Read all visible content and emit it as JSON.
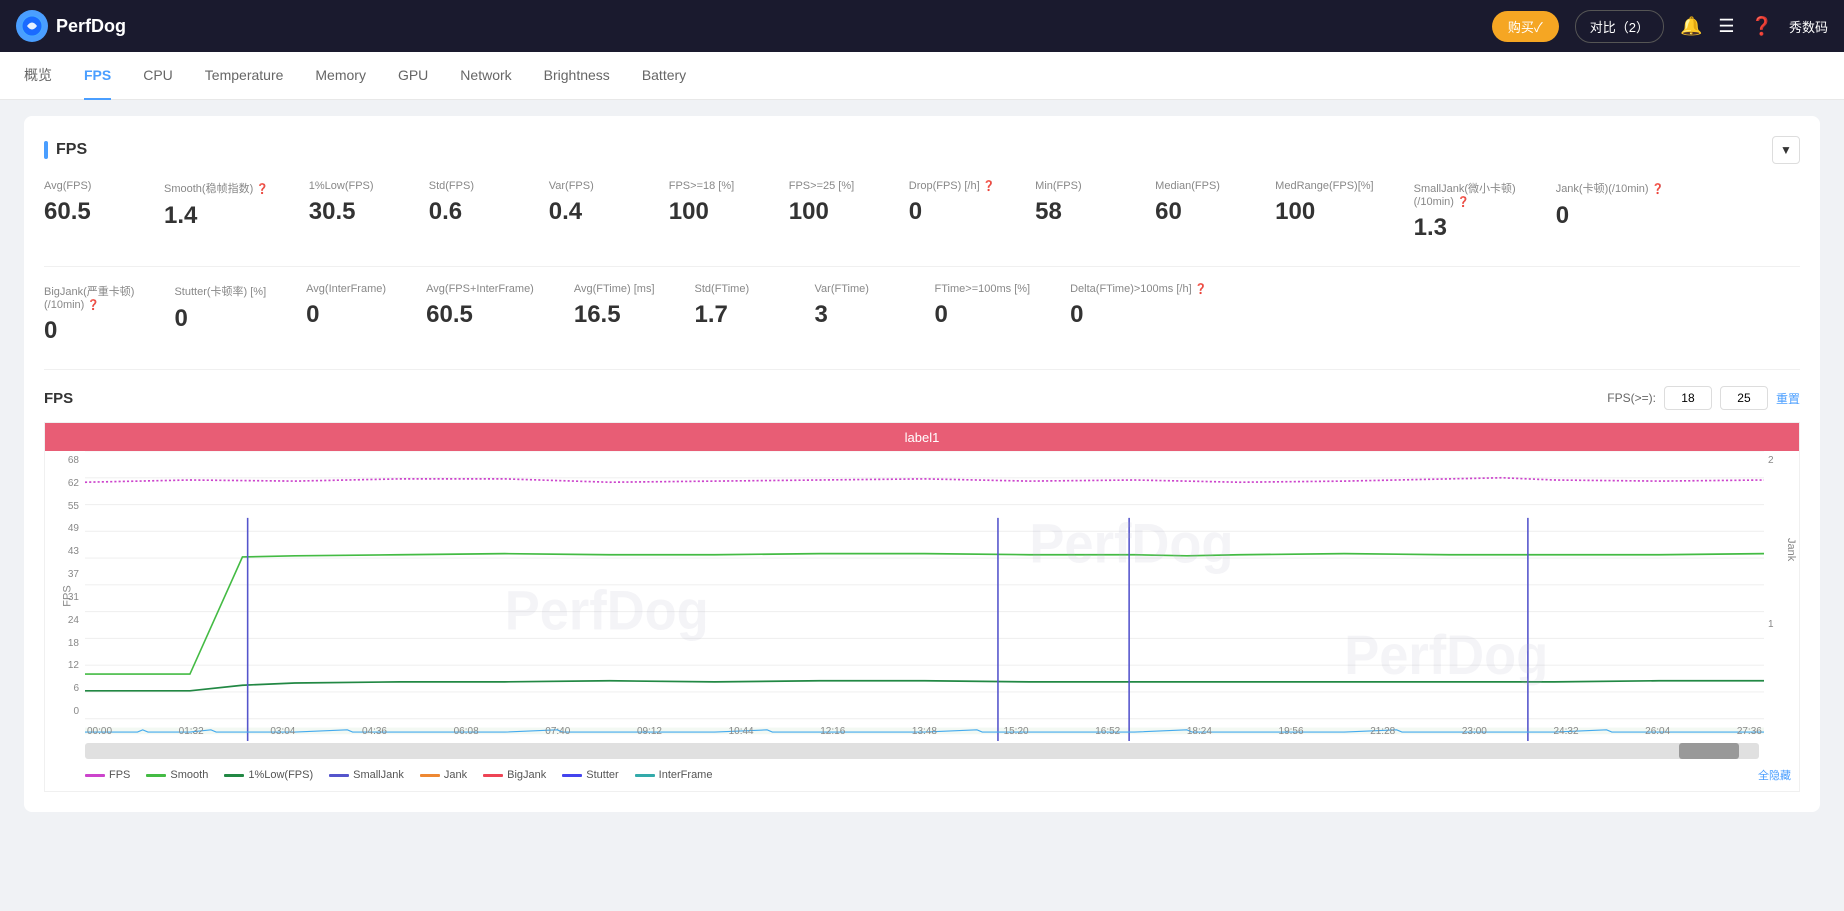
{
  "app": {
    "logo_text": "PerfDog",
    "buy_btn": "购买✓",
    "compare_btn": "对比（2）",
    "user_icon": "🔔",
    "menu_icon": "≡",
    "help_icon": "?",
    "user_text": "秀数码"
  },
  "nav": {
    "items": [
      {
        "label": "概览",
        "active": false
      },
      {
        "label": "FPS",
        "active": true
      },
      {
        "label": "CPU",
        "active": false
      },
      {
        "label": "Temperature",
        "active": false
      },
      {
        "label": "Memory",
        "active": false
      },
      {
        "label": "GPU",
        "active": false
      },
      {
        "label": "Network",
        "active": false
      },
      {
        "label": "Brightness",
        "active": false
      },
      {
        "label": "Battery",
        "active": false
      }
    ]
  },
  "fps_section": {
    "title": "FPS",
    "stats_row1": [
      {
        "label": "Avg(FPS)",
        "value": "60.5",
        "help": false
      },
      {
        "label": "Smooth(稳帧指数)",
        "value": "1.4",
        "help": true
      },
      {
        "label": "1%Low(FPS)",
        "value": "30.5",
        "help": false
      },
      {
        "label": "Std(FPS)",
        "value": "0.6",
        "help": false
      },
      {
        "label": "Var(FPS)",
        "value": "0.4",
        "help": false
      },
      {
        "label": "FPS>=18 [%]",
        "value": "100",
        "help": false
      },
      {
        "label": "FPS>=25 [%]",
        "value": "100",
        "help": false
      },
      {
        "label": "Drop(FPS) [/h]",
        "value": "0",
        "help": true
      },
      {
        "label": "Min(FPS)",
        "value": "58",
        "help": false
      },
      {
        "label": "Median(FPS)",
        "value": "60",
        "help": false
      },
      {
        "label": "MedRange(FPS)[%]",
        "value": "100",
        "help": false
      },
      {
        "label": "SmallJank(微小卡顿)(/10min)",
        "value": "1.3",
        "help": true
      },
      {
        "label": "Jank(卡顿)(/10min)",
        "value": "0",
        "help": true
      }
    ],
    "stats_row2": [
      {
        "label": "BigJank(严重卡顿)(/10min)",
        "value": "0",
        "help": true
      },
      {
        "label": "Stutter(卡顿率) [%]",
        "value": "0",
        "help": false
      },
      {
        "label": "Avg(InterFrame)",
        "value": "0",
        "help": false
      },
      {
        "label": "Avg(FPS+InterFrame)",
        "value": "60.5",
        "help": false
      },
      {
        "label": "Avg(FTime) [ms]",
        "value": "16.5",
        "help": false
      },
      {
        "label": "Std(FTime)",
        "value": "1.7",
        "help": false
      },
      {
        "label": "Var(FTime)",
        "value": "3",
        "help": false
      },
      {
        "label": "FTime>=100ms [%]",
        "value": "0",
        "help": false
      },
      {
        "label": "Delta(FTime)>100ms [/h]",
        "value": "0",
        "help": true
      }
    ],
    "chart": {
      "title": "FPS",
      "fps_gte_label": "FPS(>=):",
      "fps_val1": "18",
      "fps_val2": "25",
      "reset_btn": "重置",
      "label1": "label1",
      "y_axis_values": [
        "68",
        "62",
        "55",
        "49",
        "43",
        "37",
        "31",
        "24",
        "18",
        "12",
        "6",
        "0"
      ],
      "y_axis_right": [
        "2",
        "",
        "",
        "",
        "",
        "",
        "",
        "1",
        "",
        "",
        "",
        ""
      ],
      "x_axis_values": [
        "00:00",
        "01:32",
        "03:04",
        "04:36",
        "06:08",
        "07:40",
        "09:12",
        "10:44",
        "12:16",
        "13:48",
        "15:20",
        "16:52",
        "18:24",
        "19:56",
        "21:28",
        "23:00",
        "24:32",
        "26:04",
        "27:36"
      ],
      "y_label": "FPS",
      "jank_label": "Jank"
    },
    "legend": [
      {
        "label": "FPS",
        "color": "#cc44cc",
        "type": "dot"
      },
      {
        "label": "Smooth",
        "color": "#44bb44",
        "type": "line"
      },
      {
        "label": "1%Low(FPS)",
        "color": "#228844",
        "type": "line"
      },
      {
        "label": "SmallJank",
        "color": "#5555cc",
        "type": "bar"
      },
      {
        "label": "Jank",
        "color": "#ee8833",
        "type": "bar"
      },
      {
        "label": "BigJank",
        "color": "#ee4455",
        "type": "bar"
      },
      {
        "label": "Stutter",
        "color": "#4444ee",
        "type": "line"
      },
      {
        "label": "InterFrame",
        "color": "#33aaaa",
        "type": "line"
      }
    ],
    "hide_all_btn": "全隐藏"
  }
}
